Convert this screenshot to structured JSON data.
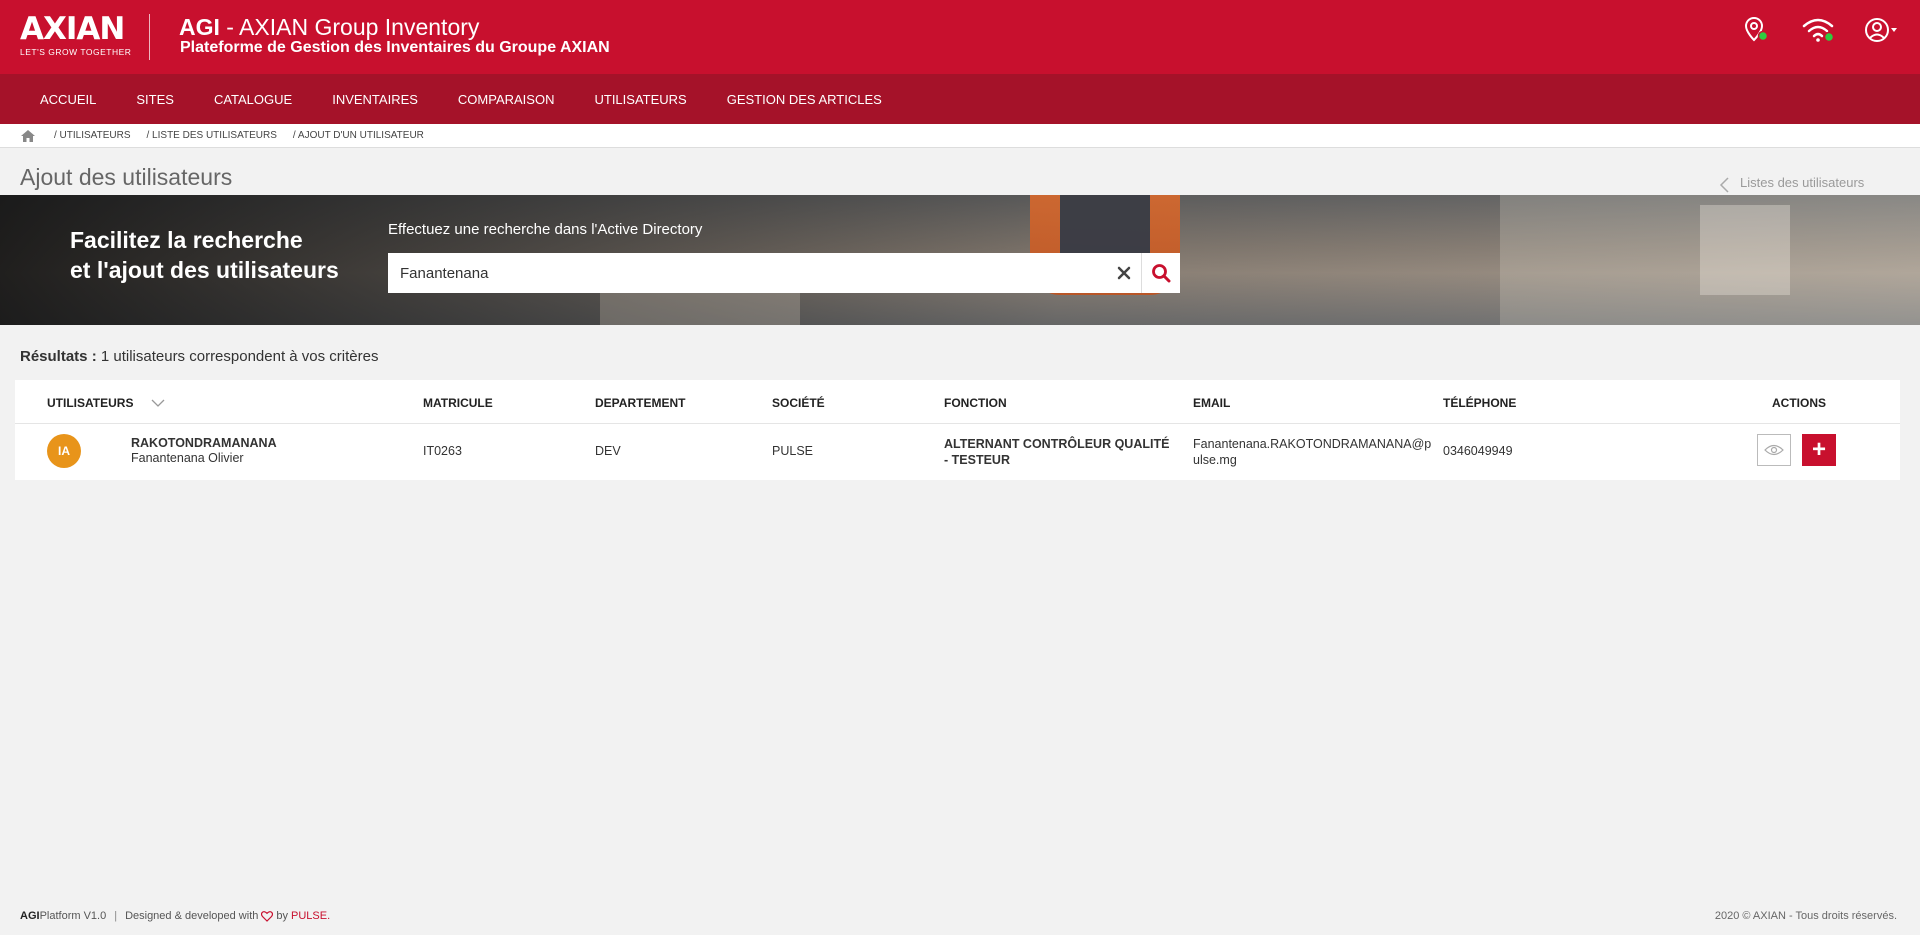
{
  "header": {
    "logo_word": "AXIAN",
    "logo_tagline": "LET'S GROW TOGETHER",
    "app_short": "AGI",
    "app_title_rest": " - AXIAN Group Inventory",
    "app_subtitle": "Plateforme de Gestion des Inventaires du Groupe AXIAN",
    "icons": [
      "location-pin-icon",
      "wifi-icon",
      "user-account-icon"
    ]
  },
  "nav": {
    "items": [
      {
        "label": "ACCUEIL"
      },
      {
        "label": "SITES"
      },
      {
        "label": "CATALOGUE"
      },
      {
        "label": "INVENTAIRES"
      },
      {
        "label": "COMPARAISON"
      },
      {
        "label": "UTILISATEURS"
      },
      {
        "label": "GESTION DES ARTICLES"
      }
    ]
  },
  "breadcrumb": {
    "items": [
      {
        "label": "/ UTILISATEURS"
      },
      {
        "label": "/ LISTE DES UTILISATEURS"
      },
      {
        "label": "/ AJOUT D'UN UTILISATEUR"
      }
    ]
  },
  "page": {
    "title": "Ajout des utilisateurs",
    "back_link": "Listes des utilisateurs"
  },
  "banner": {
    "line1": "Facilitez la recherche",
    "line2": "et l'ajout des utilisateurs",
    "search_label": "Effectuez une recherche dans l'Active Directory",
    "search_value": "Fanantenana"
  },
  "results": {
    "label_bold": "Résultats :",
    "label_text": " 1 utilisateurs correspondent à vos critères"
  },
  "table": {
    "headers": {
      "utilisateurs": "UTILISATEURS",
      "matricule": "MATRICULE",
      "departement": "DEPARTEMENT",
      "societe": "SOCIÉTÉ",
      "fonction": "FONCTION",
      "email": "EMAIL",
      "telephone": "TÉLÉPHONE",
      "actions": "ACTIONS"
    },
    "rows": [
      {
        "initials": "IA",
        "last_name": "RAKOTONDRAMANANA",
        "first_name": "Fanantenana Olivier",
        "matricule": "IT0263",
        "departement": "DEV",
        "societe": "PULSE",
        "fonction": "ALTERNANT CONTRÔLEUR QUALITÉ - TESTEUR",
        "email": "Fanantenana.RAKOTONDRAMANANA@pulse.mg",
        "telephone": "0346049949",
        "add_label": "+"
      }
    ]
  },
  "footer": {
    "brand": "AGI",
    "platform": " Platform V1.0",
    "separator": "|",
    "designed": "Designed & developed with",
    "by": "by",
    "company": "PULSE.",
    "copyright": "2020 © AXIAN - Tous droits réservés."
  },
  "colors": {
    "brand_red": "#c8102e",
    "nav_red": "#a51229",
    "avatar_orange": "#e8941a"
  }
}
